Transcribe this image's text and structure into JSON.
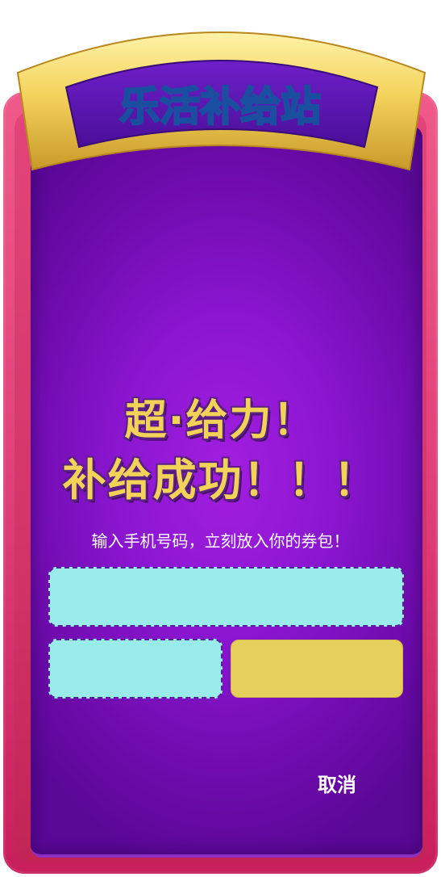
{
  "banner": {
    "title": "乐活补给站"
  },
  "headline": {
    "line1": "超·给力！",
    "line2": "补给成功！！！"
  },
  "form": {
    "hint": "输入手机号码，立刻放入你的券包！",
    "phone_value": "",
    "code_value": "",
    "submit_label": ""
  },
  "actions": {
    "cancel_label": "取消"
  },
  "colors": {
    "frame": "#e0447a",
    "panel": "#8a16d0",
    "gold": "#f2d257",
    "field": "#9aecea",
    "button": "#e6cf5b",
    "title_text": "#5cf0f5"
  }
}
